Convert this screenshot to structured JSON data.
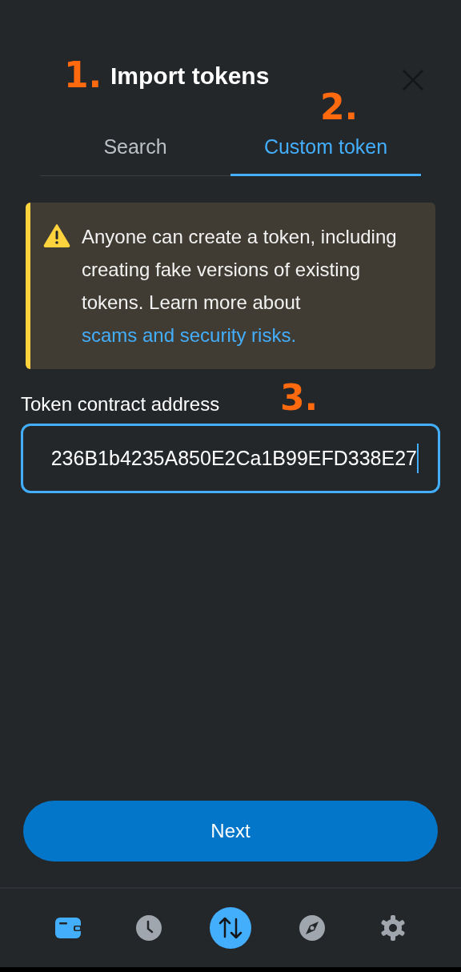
{
  "header": {
    "title": "Import tokens"
  },
  "annotations": [
    {
      "label": "1."
    },
    {
      "label": "2."
    },
    {
      "label": "3."
    }
  ],
  "tabs": [
    {
      "label": "Search",
      "selected": false
    },
    {
      "label": "Custom token",
      "selected": true
    }
  ],
  "warning": {
    "text": "Anyone can create a token, including creating fake versions of existing tokens. Learn more about",
    "link": "scams and security risks."
  },
  "address_field": {
    "label": "Token contract address",
    "value": "236B1b4235A850E2Ca1B99EFD338E27"
  },
  "next_button": {
    "label": "Next"
  },
  "bottom_nav": [
    {
      "kind": "wallet",
      "selected": true
    },
    {
      "kind": "activity",
      "selected": false
    },
    {
      "kind": "swap"
    },
    {
      "kind": "explore",
      "selected": false
    },
    {
      "kind": "settings",
      "selected": false
    }
  ]
}
